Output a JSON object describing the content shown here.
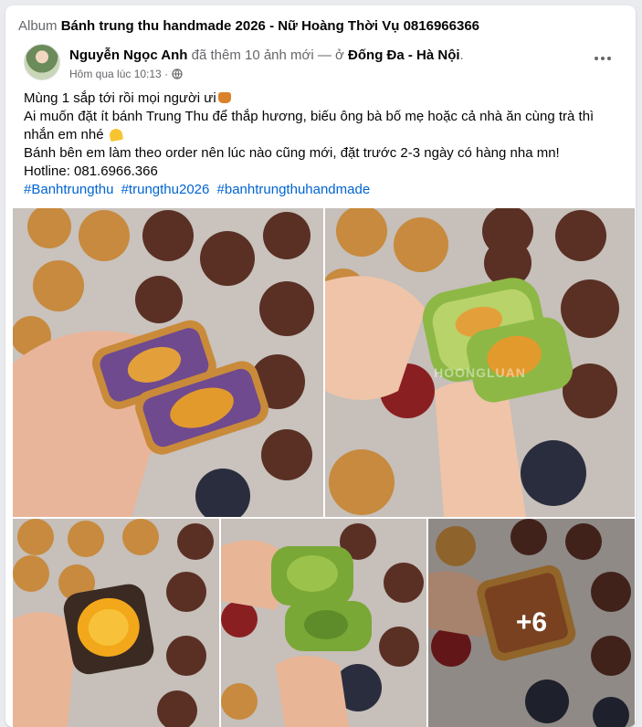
{
  "album": {
    "prefix": "Album",
    "title": "Bánh trung thu handmade 2026 - Nữ Hoàng Thời Vụ 0816966366"
  },
  "post": {
    "author": "Nguyễn Ngọc Anh",
    "action": "đã thêm 10 ảnh mới — ở",
    "location": "Đống Đa - Hà Nội",
    "location_suffix": ".",
    "time": "Hôm qua lúc 10:13 ·",
    "lines": [
      "Mùng 1 sắp tới rồi mọi người ưi",
      "Ai muốn đặt ít bánh Trung Thu để thắp hương, biếu ông bà bố mẹ hoặc cả nhà ăn cùng trà thì nhắn em nhé",
      "Bánh bên em làm theo order nên lúc nào cũng mới, đặt trước 2-3 ngày có hàng nha mn!",
      "Hotline: 081.6966.366"
    ],
    "hashtags": [
      "#Banhtrungthu",
      "#trungthu2026",
      "#banhtrungthuhandmade"
    ]
  },
  "photos": {
    "more_count_label": "+6",
    "watermark": "HOONGLUAN"
  },
  "icons": {
    "globe": "globe-icon",
    "more": "more-options-icon",
    "cake": "mooncake-emoji-icon",
    "heart": "yellow-heart-emoji-icon"
  },
  "colors": {
    "hashtag": "#0064d1",
    "muted": "#65676b",
    "card_bg": "#ffffff",
    "page_bg": "#e9ebee"
  }
}
